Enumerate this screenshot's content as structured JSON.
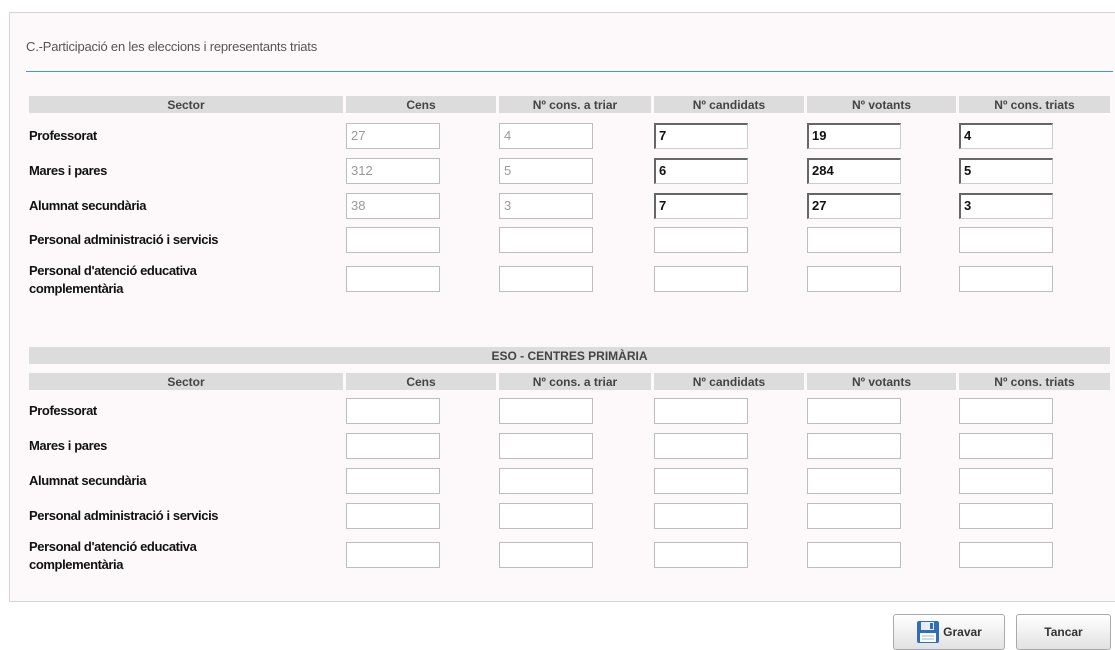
{
  "section": {
    "title": "C.-Participació en les eleccions i representants triats"
  },
  "columns": [
    "Sector",
    "Cens",
    "Nº cons. a triar",
    "Nº candidats",
    "Nº votants",
    "Nº cons. triats"
  ],
  "table1": {
    "rows": [
      {
        "sector": "Professorat",
        "values": [
          "27",
          "4",
          "7",
          "19",
          "4"
        ]
      },
      {
        "sector": "Mares i pares",
        "values": [
          "312",
          "5",
          "6",
          "284",
          "5"
        ]
      },
      {
        "sector": "Alumnat secundària",
        "values": [
          "38",
          "3",
          "7",
          "27",
          "3"
        ]
      },
      {
        "sector": "Personal administració i servicis",
        "values": [
          "",
          "",
          "",
          "",
          ""
        ]
      },
      {
        "sector": "Personal d'atenció educativa complementària",
        "values": [
          "",
          "",
          "",
          "",
          ""
        ]
      }
    ]
  },
  "table2": {
    "group_title": "ESO - CENTRES PRIMÀRIA",
    "rows": [
      {
        "sector": "Professorat",
        "values": [
          "",
          "",
          "",
          "",
          ""
        ]
      },
      {
        "sector": "Mares i pares",
        "values": [
          "",
          "",
          "",
          "",
          ""
        ]
      },
      {
        "sector": "Alumnat secundària",
        "values": [
          "",
          "",
          "",
          "",
          ""
        ]
      },
      {
        "sector": "Personal administració i servicis",
        "values": [
          "",
          "",
          "",
          "",
          ""
        ]
      },
      {
        "sector": "Personal d'atenció educativa complementària",
        "values": [
          "",
          "",
          "",
          "",
          ""
        ]
      }
    ]
  },
  "buttons": {
    "save": {
      "label": "Gravar",
      "icon": "floppy-disk-icon"
    },
    "close": {
      "label": "Tancar"
    }
  },
  "colors": {
    "accent": "#3d9ad1",
    "header_bg": "#dcdcdc",
    "panel_bg": "#fdf8fa"
  }
}
